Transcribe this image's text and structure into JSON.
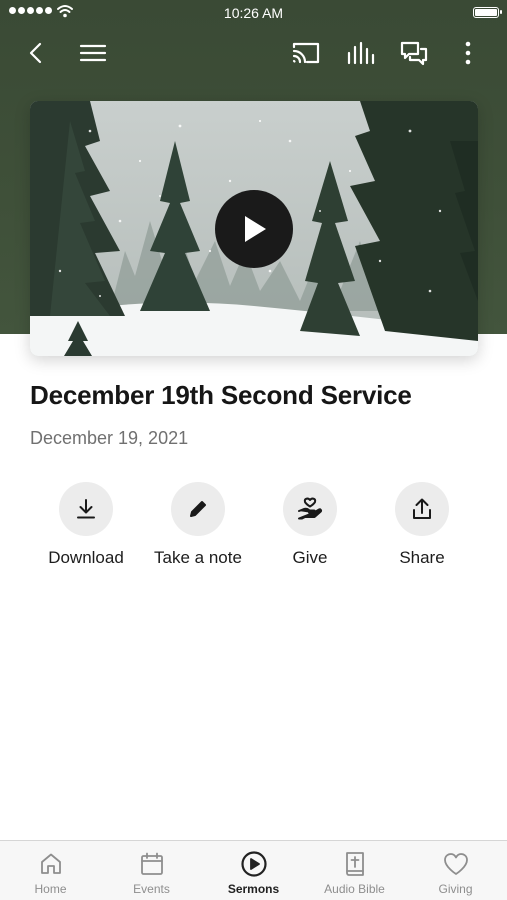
{
  "status_bar": {
    "time": "10:26 AM"
  },
  "nav": {
    "icons": [
      "back-icon",
      "menu-icon",
      "cast-icon",
      "audio-bars-icon",
      "chat-icon",
      "more-vertical-icon"
    ]
  },
  "video": {
    "thumbnail": "snowy-forest",
    "play_icon": "play-icon"
  },
  "sermon": {
    "title": "December 19th Second Service",
    "date": "December 19, 2021"
  },
  "actions": [
    {
      "label": "Download",
      "icon": "download-icon"
    },
    {
      "label": "Take a note",
      "icon": "pencil-icon"
    },
    {
      "label": "Give",
      "icon": "give-hand-heart-icon"
    },
    {
      "label": "Share",
      "icon": "share-icon"
    }
  ],
  "tabs": [
    {
      "label": "Home",
      "icon": "home-icon",
      "active": false
    },
    {
      "label": "Events",
      "icon": "calendar-icon",
      "active": false
    },
    {
      "label": "Sermons",
      "icon": "play-circle-icon",
      "active": true
    },
    {
      "label": "Audio Bible",
      "icon": "bible-icon",
      "active": false
    },
    {
      "label": "Giving",
      "icon": "heart-icon",
      "active": false
    }
  ],
  "colors": {
    "header_bg": "#3f5039",
    "action_circle": "#ececec",
    "tab_active": "#222222",
    "tab_inactive": "#8e8e8e"
  }
}
